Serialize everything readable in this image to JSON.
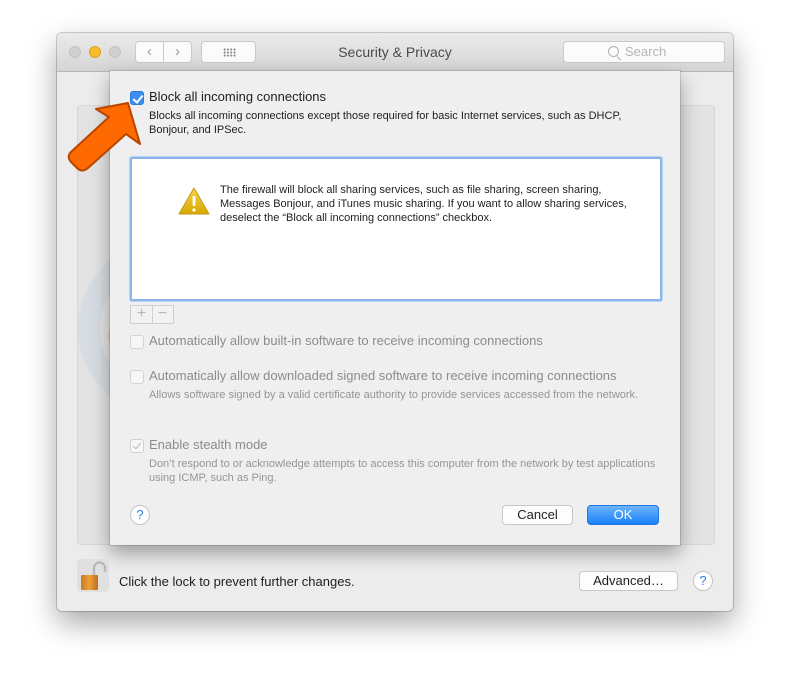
{
  "window": {
    "title": "Security & Privacy",
    "search_placeholder": "Search",
    "nav": {
      "back": "‹",
      "forward": "›"
    }
  },
  "sheet": {
    "block_all": {
      "label": "Block all incoming connections",
      "checked": true,
      "description": "Blocks all incoming connections except those required for basic Internet services, such as DHCP, Bonjour, and IPSec."
    },
    "alert": {
      "icon": "warning-icon",
      "message": "The firewall will block all sharing services, such as file sharing, screen sharing, Messages Bonjour, and iTunes music sharing. If you want to allow sharing services, deselect the “Block all incoming connections” checkbox."
    },
    "list_controls": {
      "add": "+",
      "remove": "−"
    },
    "auto_builtin": {
      "label": "Automatically allow built-in software to receive incoming connections",
      "checked": false
    },
    "auto_signed": {
      "label": "Automatically allow downloaded signed software to receive incoming connections",
      "checked": false,
      "description": "Allows software signed by a valid certificate authority to provide services accessed from the network."
    },
    "stealth": {
      "label": "Enable stealth mode",
      "checked": true,
      "description": "Don’t respond to or acknowledge attempts to access this computer from the network by test applications using ICMP, such as Ping."
    },
    "help": "?",
    "cancel_label": "Cancel",
    "ok_label": "OK"
  },
  "footer": {
    "lock_text": "Click the lock to prevent further changes.",
    "advanced_label": "Advanced…",
    "help": "?"
  },
  "colors": {
    "accent": "#1a82fb",
    "annotation_arrow": "#ff6a00",
    "warning": "#e8b800"
  }
}
